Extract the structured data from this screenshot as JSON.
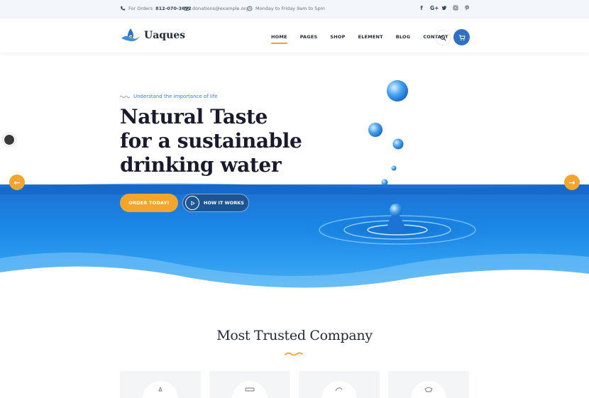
{
  "topbar": {
    "order_label": "For Orders",
    "order_phone": "812-070-3692",
    "email": "donations@example.org",
    "hours": "Monday to Friday 9am to 5pm",
    "social": [
      "f",
      "G+",
      "t",
      "ig",
      "p"
    ]
  },
  "header": {
    "logo_text": "Uaques",
    "nav": [
      "HOME",
      "PAGES",
      "SHOP",
      "ELEMENT",
      "BLOG",
      "CONTACT"
    ],
    "active_nav": "HOME"
  },
  "hero": {
    "eyebrow": "Understand the importance of life",
    "headline": [
      "Natural Taste",
      "for a sustainable",
      "drinking water"
    ],
    "order_button": "ORDER TODAY!",
    "how_button": "HOW IT WORKS",
    "prev_arrow": "←",
    "next_arrow": "→"
  },
  "section": {
    "title": "Most Trusted Company"
  },
  "colors": {
    "accent": "#f4a52b",
    "brand_blue": "#2f6fc4",
    "heading": "#1a1a2e"
  },
  "icons": [
    "phone-icon",
    "email-icon",
    "clock-icon",
    "search-icon",
    "cart-icon",
    "play-icon"
  ]
}
